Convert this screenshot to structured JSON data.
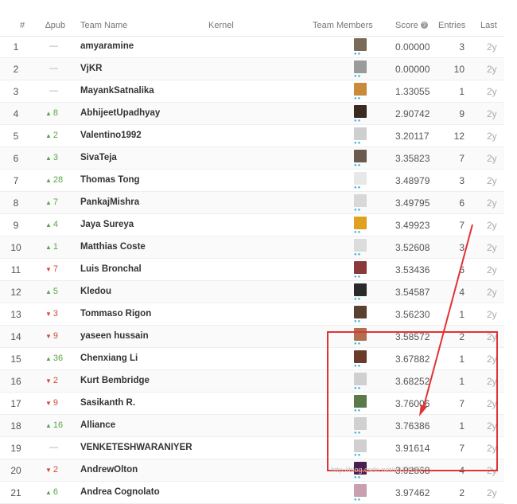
{
  "header": {
    "num": "#",
    "pub": "∆pub",
    "team": "Team Name",
    "kernel": "Kernel",
    "members": "Team Members",
    "score": "Score",
    "entries": "Entries",
    "last": "Last"
  },
  "rows": [
    {
      "num": "1",
      "delta": "—",
      "dir": "flat",
      "team": "amyaramine",
      "score": "0.00000",
      "entries": "3",
      "last": "2y",
      "avatar": "#7a6a58"
    },
    {
      "num": "2",
      "delta": "—",
      "dir": "flat",
      "team": "VjKR",
      "score": "0.00000",
      "entries": "10",
      "last": "2y",
      "avatar": "#9b9b9b"
    },
    {
      "num": "3",
      "delta": "—",
      "dir": "flat",
      "team": "MayankSatnalika",
      "score": "1.33055",
      "entries": "1",
      "last": "2y",
      "avatar": "#c98a3a"
    },
    {
      "num": "4",
      "delta": "8",
      "dir": "up",
      "team": "AbhijeetUpadhyay",
      "score": "2.90742",
      "entries": "9",
      "last": "2y",
      "avatar": "#3a2a20"
    },
    {
      "num": "5",
      "delta": "2",
      "dir": "up",
      "team": "Valentino1992",
      "score": "3.20117",
      "entries": "12",
      "last": "2y",
      "avatar": "#cfcfcf"
    },
    {
      "num": "6",
      "delta": "3",
      "dir": "up",
      "team": "SivaTeja",
      "score": "3.35823",
      "entries": "7",
      "last": "2y",
      "avatar": "#6a5a50"
    },
    {
      "num": "7",
      "delta": "28",
      "dir": "up",
      "team": "Thomas Tong",
      "score": "3.48979",
      "entries": "3",
      "last": "2y",
      "avatar": "#e8e8e8"
    },
    {
      "num": "8",
      "delta": "7",
      "dir": "up",
      "team": "PankajMishra",
      "score": "3.49795",
      "entries": "6",
      "last": "2y",
      "avatar": "#d8d8d8"
    },
    {
      "num": "9",
      "delta": "4",
      "dir": "up",
      "team": "Jaya Sureya",
      "score": "3.49923",
      "entries": "7",
      "last": "2y",
      "avatar": "#e0a020"
    },
    {
      "num": "10",
      "delta": "1",
      "dir": "up",
      "team": "Matthias Coste",
      "score": "3.52608",
      "entries": "3",
      "last": "2y",
      "avatar": "#dcdcdc"
    },
    {
      "num": "11",
      "delta": "7",
      "dir": "down",
      "team": "Luis Bronchal",
      "score": "3.53436",
      "entries": "6",
      "last": "2y",
      "avatar": "#8a3a3a"
    },
    {
      "num": "12",
      "delta": "5",
      "dir": "up",
      "team": "Kledou",
      "score": "3.54587",
      "entries": "4",
      "last": "2y",
      "avatar": "#2a2a2a"
    },
    {
      "num": "13",
      "delta": "3",
      "dir": "down",
      "team": "Tommaso Rigon",
      "score": "3.56230",
      "entries": "1",
      "last": "2y",
      "avatar": "#5a4030"
    },
    {
      "num": "14",
      "delta": "9",
      "dir": "down",
      "team": "yaseen hussain",
      "score": "3.58572",
      "entries": "2",
      "last": "2y",
      "avatar": "#b07050"
    },
    {
      "num": "15",
      "delta": "36",
      "dir": "up",
      "team": "Chenxiang Li",
      "score": "3.67882",
      "entries": "1",
      "last": "2y",
      "avatar": "#6a3a2a"
    },
    {
      "num": "16",
      "delta": "2",
      "dir": "down",
      "team": "Kurt Bembridge",
      "score": "3.68252",
      "entries": "1",
      "last": "2y",
      "avatar": "#d0d0d0"
    },
    {
      "num": "17",
      "delta": "9",
      "dir": "down",
      "team": "Sasikanth R.",
      "score": "3.76006",
      "entries": "7",
      "last": "2y",
      "avatar": "#5a7a4a"
    },
    {
      "num": "18",
      "delta": "16",
      "dir": "up",
      "team": "Alliance",
      "score": "3.76386",
      "entries": "1",
      "last": "2y",
      "avatar": "#d0d0d0"
    },
    {
      "num": "19",
      "delta": "—",
      "dir": "flat",
      "team": "VENKETESHWARANIYER",
      "score": "3.91614",
      "entries": "7",
      "last": "2y",
      "avatar": "#d0d0d0"
    },
    {
      "num": "20",
      "delta": "2",
      "dir": "down",
      "team": "AndrewOlton",
      "score": "3.92868",
      "entries": "4",
      "last": "2y",
      "avatar": "#4a2050"
    },
    {
      "num": "21",
      "delta": "6",
      "dir": "up",
      "team": "Andrea Cognolato",
      "score": "3.97462",
      "entries": "2",
      "last": "2y",
      "avatar": "#c8a0b0"
    }
  ],
  "colors": {
    "up": "#5aa34a",
    "down": "#d04a3c",
    "annotation": "#e03434"
  },
  "watermark": "http://blog.csdn.net/u010193"
}
